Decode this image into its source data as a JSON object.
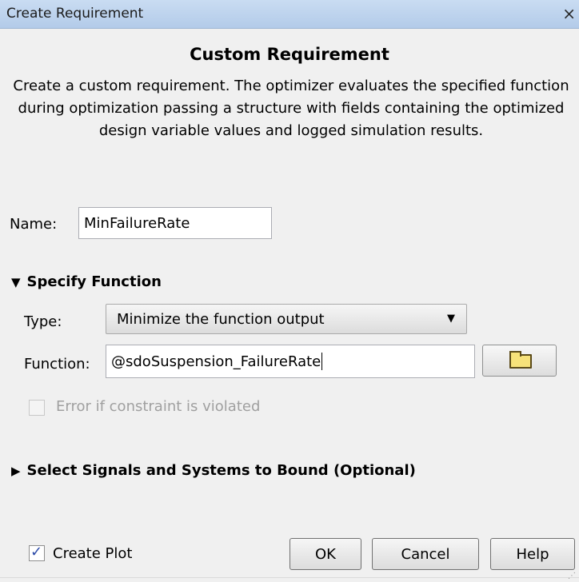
{
  "window": {
    "title": "Create Requirement",
    "close_glyph": "×"
  },
  "header": {
    "title": "Custom Requirement",
    "description": "Create a custom requirement. The optimizer evaluates the specified function during optimization passing a structure with fields containing the optimized design variable values and logged simulation results."
  },
  "name_field": {
    "label": "Name:",
    "value": "MinFailureRate"
  },
  "specify_function": {
    "header": "Specify Function",
    "expanded": true,
    "type_label": "Type:",
    "type_value": "Minimize the function output",
    "function_label": "Function:",
    "function_value": "@sdoSuspension_FailureRate",
    "browse_icon": "folder-icon",
    "error_checkbox_label": "Error if constraint is violated",
    "error_checkbox_checked": false,
    "error_checkbox_enabled": false
  },
  "select_signals": {
    "header": "Select Signals and Systems to Bound (Optional)",
    "expanded": false
  },
  "footer": {
    "create_plot_label": "Create Plot",
    "create_plot_checked": true,
    "ok_label": "OK",
    "cancel_label": "Cancel",
    "help_label": "Help"
  },
  "icons": {
    "expanded": "▼",
    "collapsed": "▶",
    "dropdown_caret": "▼",
    "check": "✓"
  },
  "colors": {
    "title_bar": "#b3cbe9",
    "window_bg": "#f0f0f0",
    "checkmark": "#2b4aa8"
  }
}
